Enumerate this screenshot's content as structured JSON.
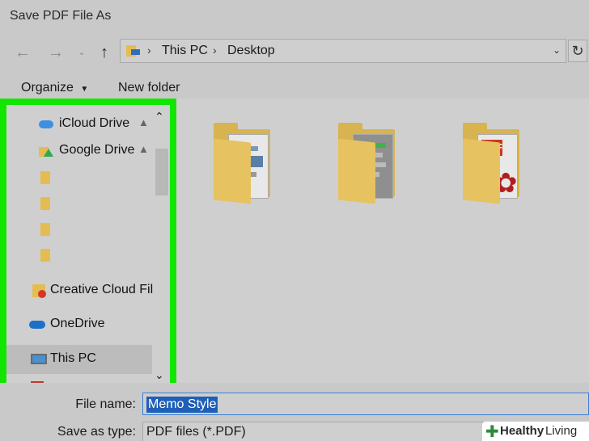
{
  "window": {
    "title": "Save PDF File As"
  },
  "nav": {
    "back_icon": "arrow-left-icon",
    "forward_icon": "arrow-right-icon",
    "recent_icon": "chevron-down-icon",
    "up_icon": "arrow-up-icon",
    "breadcrumbs": [
      "This PC",
      "Desktop"
    ],
    "refresh_icon": "refresh-icon"
  },
  "toolbar": {
    "organize_label": "Organize",
    "new_folder_label": "New folder"
  },
  "sidebar": {
    "items": [
      {
        "label": "iCloud Drive",
        "icon": "icloud-icon"
      },
      {
        "label": "Google Drive",
        "icon": "google-drive-icon"
      },
      {
        "label": "",
        "icon": "folder-icon"
      },
      {
        "label": "",
        "icon": "folder-icon"
      },
      {
        "label": "",
        "icon": "folder-icon"
      },
      {
        "label": "",
        "icon": "folder-icon"
      },
      {
        "label": "Creative Cloud Fil",
        "icon": "creative-cloud-icon"
      },
      {
        "label": "OneDrive",
        "icon": "onedrive-icon"
      },
      {
        "label": "This PC",
        "icon": "this-pc-icon"
      }
    ]
  },
  "files": [
    {
      "name": "",
      "icon": "folder-icon"
    },
    {
      "name": "",
      "icon": "folder-icon"
    },
    {
      "name": "",
      "icon": "folder-pdf-icon"
    }
  ],
  "footer": {
    "file_name_label": "File name:",
    "file_name_value": "Memo Style",
    "save_type_label": "Save as type:",
    "save_type_value": "PDF files (*.PDF)"
  },
  "watermark": {
    "brand_bold": "Healthy",
    "brand_light": "Living"
  },
  "colors": {
    "highlight_border": "#12e600",
    "selection": "#1e5fb8"
  }
}
